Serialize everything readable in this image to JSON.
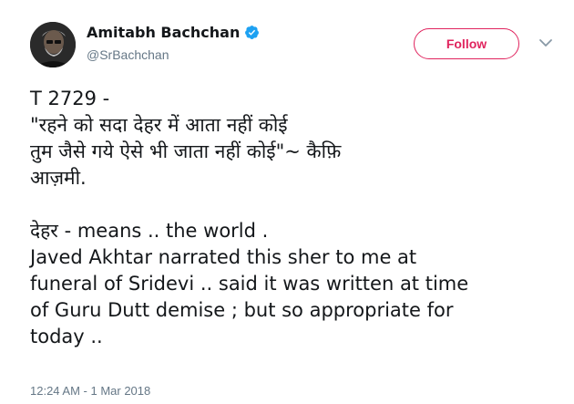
{
  "author": {
    "display_name": "Amitabh Bachchan",
    "handle": "@SrBachchan",
    "verified": true
  },
  "follow_button": {
    "label": "Follow"
  },
  "menu": {
    "icon": "chevron-down-icon"
  },
  "tweet": {
    "lines": [
      "T 2729 -",
      "\"रहने को सदा देहर में आता नहीं कोई",
      "तुम जैसे गये ऐसे भी जाता नहीं कोई\"~   कैफ़ि",
      "आज़मी.",
      "",
      "देहर - means .. the world .",
      "Javed Akhtar narrated this sher to me at",
      "funeral of Sridevi .. said it was written at time",
      "of Guru Dutt demise ; but so appropriate for",
      "today .."
    ],
    "timestamp": "12:24 AM - 1 Mar 2018"
  },
  "colors": {
    "accent": "#e0245e",
    "text": "#14171a",
    "muted": "#657786",
    "verified": "#1da1f2"
  }
}
